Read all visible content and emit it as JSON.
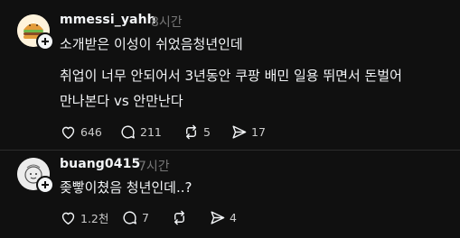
{
  "posts": [
    {
      "username": "mmessi_yahh",
      "time": "8시간",
      "lines": [
        "소개받은 이성이 쉬었음청년인데",
        "취업이 너무 안되어서 3년동안 쿠팡 배민 일용 뛰면서 돈벌어",
        "만나본다 vs 안만난다"
      ],
      "likes": "646",
      "comments": "211",
      "reposts": "5",
      "shares": "17"
    },
    {
      "username": "buang0415",
      "time": "7시간",
      "lines": [
        "좆빻이쳤음 청년인데..?"
      ],
      "likes": "1.2천",
      "comments": "7",
      "reposts": "",
      "shares": "4"
    }
  ],
  "colors": {
    "background": "#101010",
    "text": "#f3f5f7",
    "muted": "#777777",
    "divider": "#2d2d2d"
  }
}
